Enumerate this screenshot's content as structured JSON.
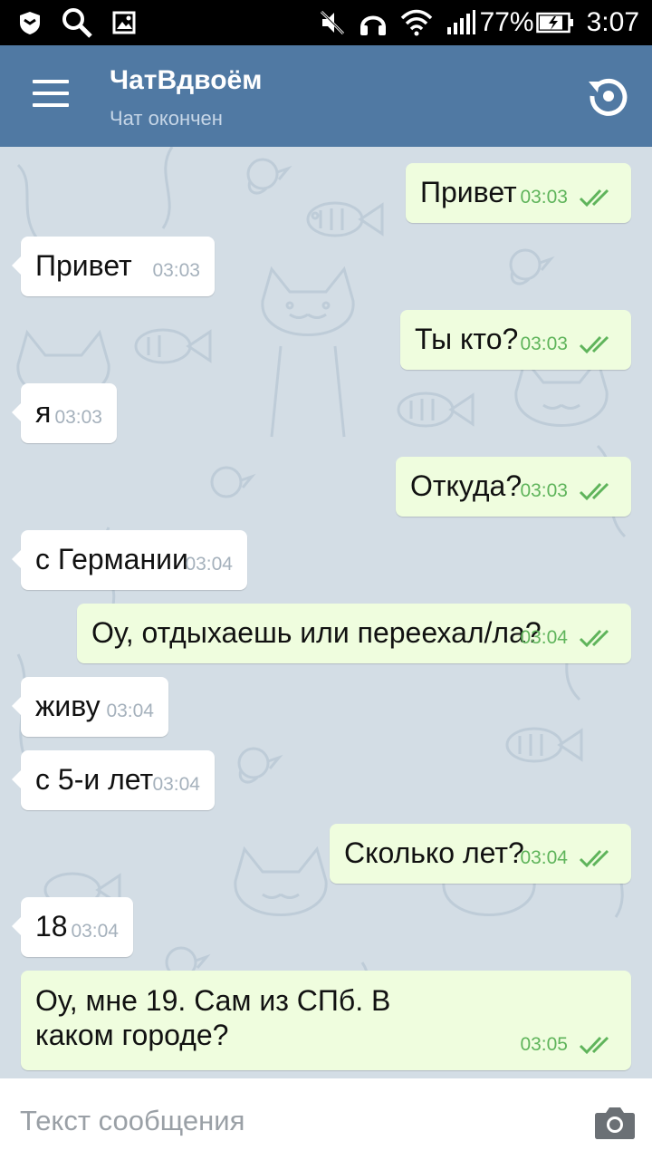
{
  "status_bar": {
    "battery": "77%",
    "time": "3:07",
    "icons": [
      "shield-icon",
      "search-icon",
      "image-icon",
      "mute-icon",
      "headphones-icon",
      "wifi-icon",
      "signal-icon",
      "battery-charging-icon"
    ]
  },
  "app_bar": {
    "title": "ЧатВдвоём",
    "subtitle": "Чат окончен",
    "menu_icon": "hamburger-menu-icon",
    "action_icon": "refresh-icon"
  },
  "messages": [
    {
      "direction": "out",
      "text": "Привет",
      "time": "03:03",
      "read": true
    },
    {
      "direction": "in",
      "text": "Привет",
      "time": "03:03"
    },
    {
      "direction": "out",
      "text": "Ты кто?",
      "time": "03:03",
      "read": true
    },
    {
      "direction": "in",
      "text": "я",
      "time": "03:03"
    },
    {
      "direction": "out",
      "text": "Откуда?",
      "time": "03:03",
      "read": true
    },
    {
      "direction": "in",
      "text": "с Германии",
      "time": "03:04"
    },
    {
      "direction": "out",
      "text": "Оу, отдыхаешь или переехал/ла?",
      "time": "03:04",
      "read": true
    },
    {
      "direction": "in",
      "text": "живу",
      "time": "03:04"
    },
    {
      "direction": "in",
      "text": "с 5-и лет",
      "time": "03:04"
    },
    {
      "direction": "out",
      "text": "Сколько лет?",
      "time": "03:04",
      "read": true
    },
    {
      "direction": "in",
      "text": "18",
      "time": "03:04"
    },
    {
      "direction": "out",
      "text": "Оу, мне 19. Сам из СПб. В каком городе?",
      "time": "03:05",
      "read": true
    }
  ],
  "input": {
    "placeholder": "Текст сообщения",
    "value": "",
    "attach_icon": "camera-icon"
  },
  "colors": {
    "app_bar": "#5079a3",
    "chat_background": "#d3dde5",
    "incoming_bubble": "#ffffff",
    "outgoing_bubble": "#effdde",
    "read_ticks": "#5fb45b"
  }
}
